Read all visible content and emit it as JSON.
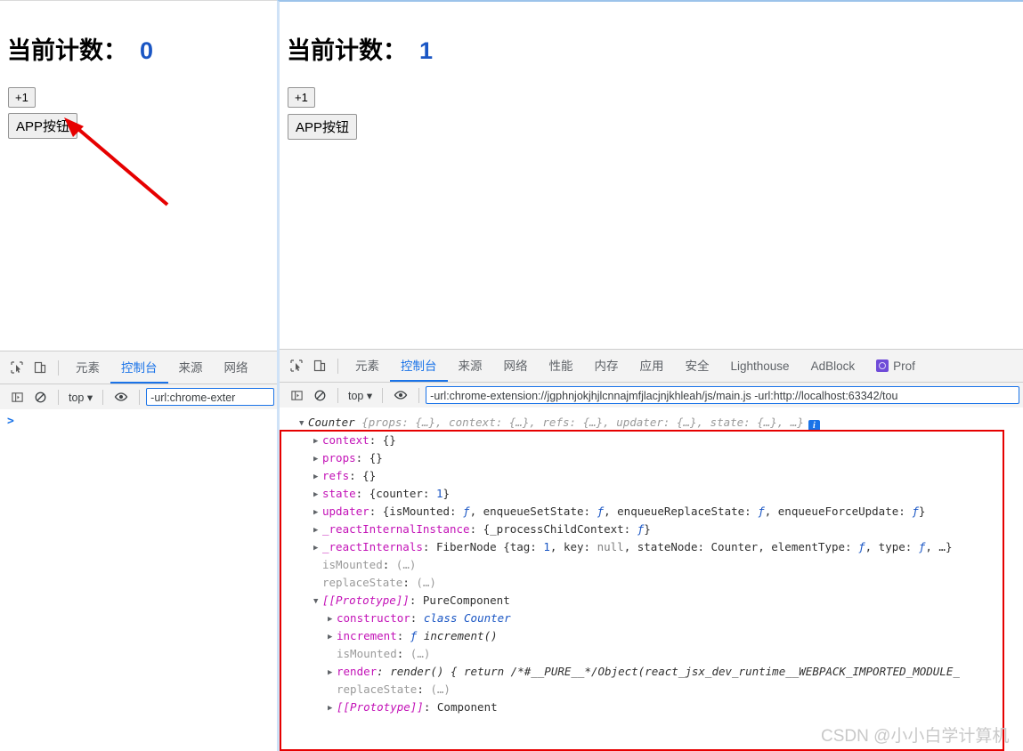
{
  "left_window": {
    "page": {
      "heading_label": "当前计数：",
      "heading_value": "0",
      "increment_button": "+1",
      "app_button": "APP按钮"
    },
    "devtools": {
      "tabs": [
        {
          "label": "元素",
          "active": false
        },
        {
          "label": "控制台",
          "active": true
        },
        {
          "label": "来源",
          "active": false
        },
        {
          "label": "网络",
          "active": false
        }
      ],
      "context": "top",
      "filter_value": "-url:chrome-exter",
      "prompt": ">"
    }
  },
  "right_window": {
    "page": {
      "heading_label": "当前计数：",
      "heading_value": "1",
      "increment_button": "+1",
      "app_button": "APP按钮"
    },
    "devtools": {
      "tabs": [
        {
          "label": "元素",
          "active": false
        },
        {
          "label": "控制台",
          "active": true
        },
        {
          "label": "来源",
          "active": false
        },
        {
          "label": "网络",
          "active": false
        },
        {
          "label": "性能",
          "active": false
        },
        {
          "label": "内存",
          "active": false
        },
        {
          "label": "应用",
          "active": false
        },
        {
          "label": "安全",
          "active": false
        },
        {
          "label": "Lighthouse",
          "active": false
        },
        {
          "label": "AdBlock",
          "active": false
        },
        {
          "label": "Prof",
          "active": false,
          "icon": "react-profiler-icon"
        }
      ],
      "context": "top",
      "filter_value": "-url:chrome-extension://jgphnjokjhjlcnnajmfjlacjnjkhleah/js/main.js -url:http://localhost:63342/tou",
      "console_tree": [
        {
          "indent": 0,
          "toggle": "open",
          "segments": [
            {
              "t": "Counter ",
              "c": "plain ital"
            },
            {
              "t": "{props: {…}, context: {…}, refs: {…}, updater: {…}, state: {…}, …}",
              "c": "kg ital"
            }
          ],
          "info_badge": "i"
        },
        {
          "indent": 1,
          "toggle": "closed",
          "segments": [
            {
              "t": "context",
              "c": "k"
            },
            {
              "t": ": ",
              "c": "plain"
            },
            {
              "t": "{}",
              "c": "plain"
            }
          ]
        },
        {
          "indent": 1,
          "toggle": "closed",
          "segments": [
            {
              "t": "props",
              "c": "k"
            },
            {
              "t": ": ",
              "c": "plain"
            },
            {
              "t": "{}",
              "c": "plain"
            }
          ]
        },
        {
          "indent": 1,
          "toggle": "closed",
          "segments": [
            {
              "t": "refs",
              "c": "k"
            },
            {
              "t": ": ",
              "c": "plain"
            },
            {
              "t": "{}",
              "c": "plain"
            }
          ]
        },
        {
          "indent": 1,
          "toggle": "closed",
          "segments": [
            {
              "t": "state",
              "c": "k"
            },
            {
              "t": ": {counter: ",
              "c": "plain"
            },
            {
              "t": "1",
              "c": "num"
            },
            {
              "t": "}",
              "c": "plain"
            }
          ]
        },
        {
          "indent": 1,
          "toggle": "closed",
          "segments": [
            {
              "t": "updater",
              "c": "k"
            },
            {
              "t": ": {isMounted: ",
              "c": "plain"
            },
            {
              "t": "ƒ",
              "c": "fn"
            },
            {
              "t": ", enqueueSetState: ",
              "c": "plain"
            },
            {
              "t": "ƒ",
              "c": "fn"
            },
            {
              "t": ", enqueueReplaceState: ",
              "c": "plain"
            },
            {
              "t": "ƒ",
              "c": "fn"
            },
            {
              "t": ", enqueueForceUpdate: ",
              "c": "plain"
            },
            {
              "t": "ƒ",
              "c": "fn"
            },
            {
              "t": "}",
              "c": "plain"
            }
          ]
        },
        {
          "indent": 1,
          "toggle": "closed",
          "segments": [
            {
              "t": "_reactInternalInstance",
              "c": "k"
            },
            {
              "t": ": {_processChildContext: ",
              "c": "plain"
            },
            {
              "t": "ƒ",
              "c": "fn"
            },
            {
              "t": "}",
              "c": "plain"
            }
          ]
        },
        {
          "indent": 1,
          "toggle": "closed",
          "segments": [
            {
              "t": "_reactInternals",
              "c": "k"
            },
            {
              "t": ": FiberNode {tag: ",
              "c": "plain"
            },
            {
              "t": "1",
              "c": "num"
            },
            {
              "t": ", key: ",
              "c": "plain"
            },
            {
              "t": "null",
              "c": "nul"
            },
            {
              "t": ", stateNode: Counter, elementType: ",
              "c": "plain"
            },
            {
              "t": "ƒ",
              "c": "fn"
            },
            {
              "t": ", type: ",
              "c": "plain"
            },
            {
              "t": "ƒ",
              "c": "fn"
            },
            {
              "t": ", …}",
              "c": "plain"
            }
          ]
        },
        {
          "indent": 1,
          "toggle": "none",
          "segments": [
            {
              "t": "isMounted",
              "c": "kg"
            },
            {
              "t": ": ",
              "c": "plain"
            },
            {
              "t": "(…)",
              "c": "kg"
            }
          ]
        },
        {
          "indent": 1,
          "toggle": "none",
          "segments": [
            {
              "t": "replaceState",
              "c": "kg"
            },
            {
              "t": ": ",
              "c": "plain"
            },
            {
              "t": "(…)",
              "c": "kg"
            }
          ]
        },
        {
          "indent": 1,
          "toggle": "open",
          "segments": [
            {
              "t": "[[Prototype]]",
              "c": "k ital"
            },
            {
              "t": ": PureComponent",
              "c": "plain"
            }
          ]
        },
        {
          "indent": 2,
          "toggle": "closed",
          "segments": [
            {
              "t": "constructor",
              "c": "k"
            },
            {
              "t": ": ",
              "c": "plain"
            },
            {
              "t": "class Counter",
              "c": "fn"
            }
          ]
        },
        {
          "indent": 2,
          "toggle": "closed",
          "segments": [
            {
              "t": "increment",
              "c": "k"
            },
            {
              "t": ": ",
              "c": "plain"
            },
            {
              "t": "ƒ",
              "c": "fn"
            },
            {
              "t": " increment()",
              "c": "plain ital"
            }
          ]
        },
        {
          "indent": 2,
          "toggle": "none",
          "segments": [
            {
              "t": "isMounted",
              "c": "kg"
            },
            {
              "t": ": ",
              "c": "plain"
            },
            {
              "t": "(…)",
              "c": "kg"
            }
          ]
        },
        {
          "indent": 2,
          "toggle": "closed",
          "segments": [
            {
              "t": "render",
              "c": "k"
            },
            {
              "t": ": render() { return /*#__PURE__*/Object(react_jsx_dev_runtime__WEBPACK_IMPORTED_MODULE_",
              "c": "plain ital"
            }
          ]
        },
        {
          "indent": 2,
          "toggle": "none",
          "segments": [
            {
              "t": "replaceState",
              "c": "kg"
            },
            {
              "t": ": ",
              "c": "plain"
            },
            {
              "t": "(…)",
              "c": "kg"
            }
          ]
        },
        {
          "indent": 2,
          "toggle": "closed",
          "segments": [
            {
              "t": "[[Prototype]]",
              "c": "k ital"
            },
            {
              "t": ": Component",
              "c": "plain"
            }
          ]
        }
      ]
    }
  },
  "annotations": {
    "arrow_color": "#e60000",
    "highlight_box_color": "#e60000",
    "watermark": "CSDN @小小白学计算机"
  }
}
